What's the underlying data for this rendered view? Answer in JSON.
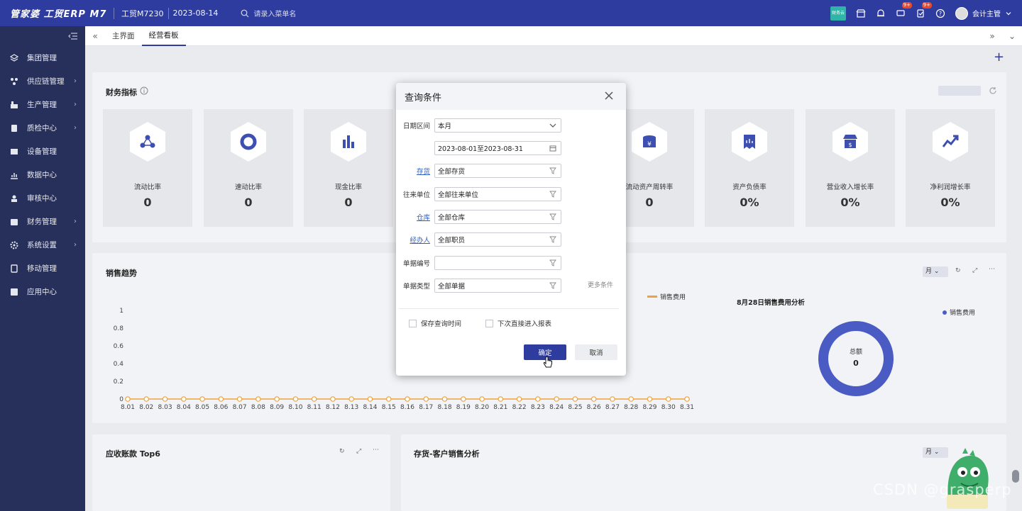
{
  "topbar": {
    "logo": "管家婆 工贸ERP M7",
    "account": "工贸M7230",
    "date": "2023-08-14",
    "search_placeholder": "请录入菜单名",
    "green_app_label": "财务云",
    "badges": {
      "messages": "9+",
      "tasks": "9+"
    },
    "user_name": "会计主管"
  },
  "sidebar": {
    "items": [
      {
        "label": "集团管理",
        "icon": "layers-icon",
        "has_children": false
      },
      {
        "label": "供应链管理",
        "icon": "supply-chain-icon",
        "has_children": true
      },
      {
        "label": "生产管理",
        "icon": "production-icon",
        "has_children": true
      },
      {
        "label": "质检中心",
        "icon": "quality-icon",
        "has_children": true
      },
      {
        "label": "设备管理",
        "icon": "equipment-icon",
        "has_children": false
      },
      {
        "label": "数据中心",
        "icon": "chart-icon",
        "has_children": false
      },
      {
        "label": "审核中心",
        "icon": "audit-icon",
        "has_children": false
      },
      {
        "label": "财务管理",
        "icon": "finance-icon",
        "has_children": true
      },
      {
        "label": "系统设置",
        "icon": "gear-icon",
        "has_children": true
      },
      {
        "label": "移动管理",
        "icon": "mobile-icon",
        "has_children": false
      },
      {
        "label": "应用中心",
        "icon": "app-icon",
        "has_children": false
      }
    ]
  },
  "tabs": [
    {
      "label": "主界面",
      "active": false
    },
    {
      "label": "经营看板",
      "active": true
    }
  ],
  "finance": {
    "title": "财务指标",
    "cards": [
      {
        "label": "流动比率",
        "value": "0",
        "icon": "nodes-icon"
      },
      {
        "label": "速动比率",
        "value": "0",
        "icon": "ring-icon"
      },
      {
        "label": "现金比率",
        "value": "0",
        "icon": "bar-chart-icon"
      },
      {
        "label": "流动资产周转率",
        "value": "0",
        "icon": "coins-icon"
      },
      {
        "label": "资产负债率",
        "value": "0%",
        "icon": "receipt-icon"
      },
      {
        "label": "营业收入增长率",
        "value": "0%",
        "icon": "store-icon"
      },
      {
        "label": "净利润增长率",
        "value": "0%",
        "icon": "trend-icon"
      }
    ]
  },
  "sales_trend": {
    "title": "销售趋势",
    "period": "月",
    "legend_expense": "销售费用",
    "donut_title": "8月28日销售费用分析",
    "donut_legend": "销售费用",
    "donut_center_label": "总额",
    "donut_center_value": "0"
  },
  "chart_data": {
    "type": "line",
    "x": [
      "8.01",
      "8.02",
      "8.03",
      "8.04",
      "8.05",
      "8.06",
      "8.07",
      "8.08",
      "8.09",
      "8.10",
      "8.11",
      "8.12",
      "8.13",
      "8.14",
      "8.15",
      "8.16",
      "8.17",
      "8.18",
      "8.19",
      "8.20",
      "8.21",
      "8.22",
      "8.23",
      "8.24",
      "8.25",
      "8.26",
      "8.27",
      "8.28",
      "8.29",
      "8.30",
      "8.31"
    ],
    "yticks": [
      "0",
      "0.2",
      "0.4",
      "0.6",
      "0.8",
      "1"
    ],
    "ylim": [
      0,
      1
    ],
    "series": [
      {
        "name": "销售费用",
        "color": "#f0a23a",
        "values": [
          0,
          0,
          0,
          0,
          0,
          0,
          0,
          0,
          0,
          0,
          0,
          0,
          0,
          0,
          0,
          0,
          0,
          0,
          0,
          0,
          0,
          0,
          0,
          0,
          0,
          0,
          0,
          0,
          0,
          0,
          0
        ]
      }
    ]
  },
  "receivables": {
    "title": "应收账款 Top6"
  },
  "inventory": {
    "title": "存货-客户销售分析",
    "period": "月"
  },
  "dialog": {
    "title": "查询条件",
    "fields": [
      {
        "label": "日期区间",
        "value": "本月",
        "link": false,
        "icon": "chevron-down-icon"
      },
      {
        "label": "",
        "value": "2023-08-01至2023-08-31",
        "link": false,
        "icon": "calendar-icon"
      },
      {
        "label": "存货",
        "value": "全部存货",
        "link": true,
        "icon": "filter-icon"
      },
      {
        "label": "往来单位",
        "value": "全部往来单位",
        "link": false,
        "icon": "filter-icon"
      },
      {
        "label": "仓库",
        "value": "全部仓库",
        "link": true,
        "icon": "filter-icon"
      },
      {
        "label": "经办人",
        "value": "全部职员",
        "link": true,
        "icon": "filter-icon"
      },
      {
        "label": "单据编号",
        "value": "",
        "link": false,
        "icon": "filter-icon"
      },
      {
        "label": "单据类型",
        "value": "全部单据",
        "link": false,
        "icon": "filter-icon"
      }
    ],
    "more_label": "更多条件",
    "checkbox_save": "保存查询时间",
    "checkbox_direct": "下次直接进入报表",
    "ok_label": "确定",
    "cancel_label": "取消"
  },
  "watermark": "CSDN @grasperp"
}
